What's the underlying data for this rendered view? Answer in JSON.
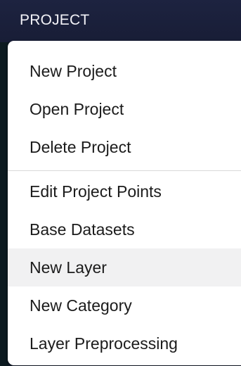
{
  "header": {
    "title": "PROJECT"
  },
  "menu": {
    "group_1": [
      {
        "label": "New Project"
      },
      {
        "label": "Open Project"
      },
      {
        "label": "Delete Project"
      }
    ],
    "group_2": [
      {
        "label": "Edit Project Points"
      },
      {
        "label": "Base Datasets"
      },
      {
        "label": "New Layer",
        "highlighted": true
      },
      {
        "label": "New Category"
      },
      {
        "label": "Layer Preprocessing"
      }
    ]
  },
  "colors": {
    "header_bg": "#1d2340",
    "menu_bg": "#ffffff",
    "hover_bg": "#f1f1f2",
    "text": "#1b1b1b"
  }
}
